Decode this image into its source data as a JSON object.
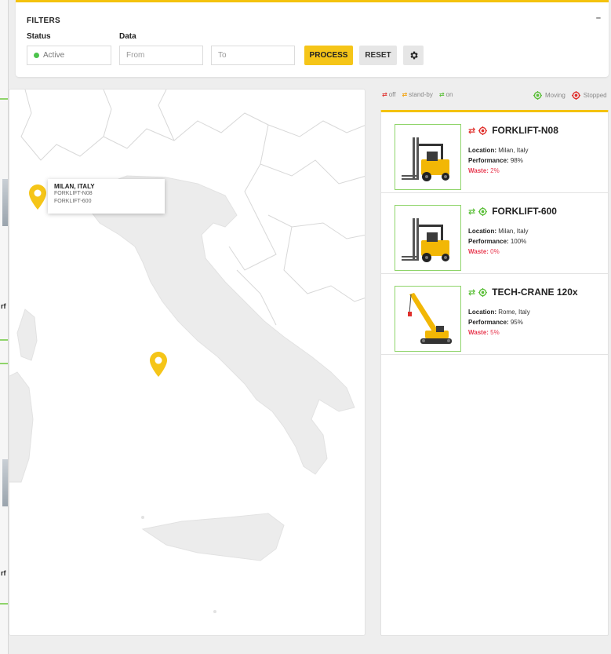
{
  "filters": {
    "title": "FILTERS",
    "collapse": "–",
    "status_label": "Status",
    "status_value": "Active",
    "data_label": "Data",
    "from_placeholder": "From",
    "to_placeholder": "To",
    "process": "PROCESS",
    "reset": "RESET"
  },
  "left_strip": {
    "rf1": "rf",
    "rf2": "rf"
  },
  "map": {
    "tooltip_title": "MILAN, ITALY",
    "tooltip_line1": "FORKLIFT-N08",
    "tooltip_line2": "FORKLIFT-600"
  },
  "legend": {
    "off": "off",
    "standby": "stand-by",
    "on": "on",
    "moving": "Moving",
    "stopped": "Stopped"
  },
  "colors": {
    "accent": "#f4c20d",
    "green": "#5cbf3a",
    "red": "#e0302c",
    "orange": "#f2a10c"
  },
  "machines": [
    {
      "name": "FORKLIFT-N08",
      "status_icon": "red",
      "motion": "stopped",
      "location_label": "Location:",
      "location": "Milan, Italy",
      "performance_label": "Performance:",
      "performance": "98%",
      "waste_label": "Waste:",
      "waste": "2%",
      "image": "forklift"
    },
    {
      "name": "FORKLIFT-600",
      "status_icon": "green",
      "motion": "moving",
      "location_label": "Location:",
      "location": "Milan, Italy",
      "performance_label": "Performance:",
      "performance": "100%",
      "waste_label": "Waste:",
      "waste": "0%",
      "image": "forklift"
    },
    {
      "name": "TECH-CRANE 120x",
      "status_icon": "green",
      "motion": "moving",
      "location_label": "Location:",
      "location": "Rome, Italy",
      "performance_label": "Performance:",
      "performance": "95%",
      "waste_label": "Waste:",
      "waste": "5%",
      "image": "crane"
    }
  ]
}
